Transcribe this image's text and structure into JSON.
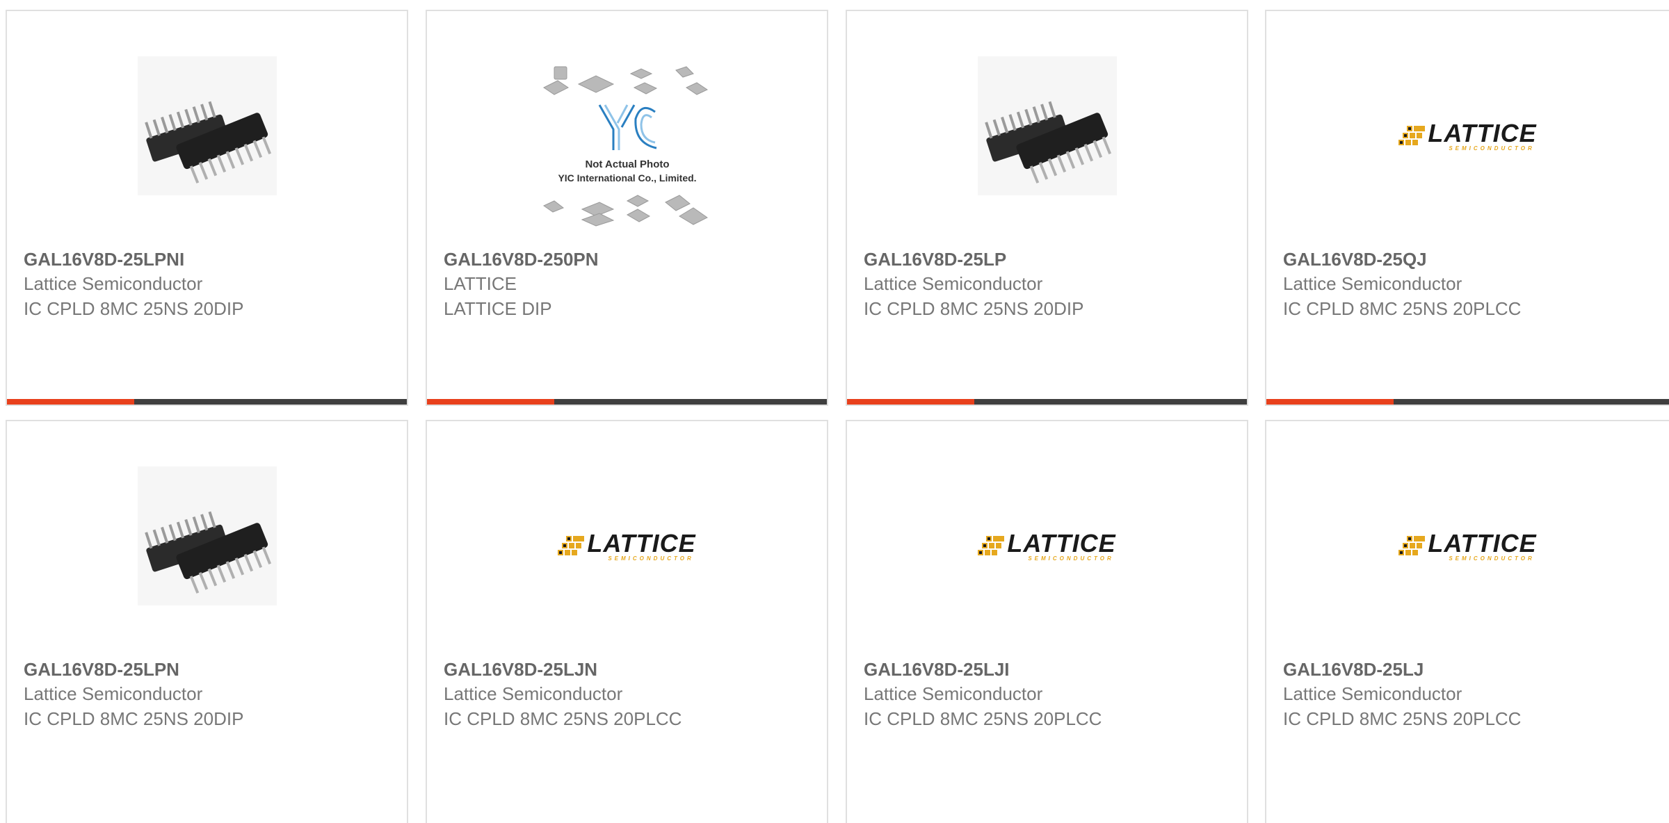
{
  "products": [
    {
      "part": "GAL16V8D-25LPNI",
      "manufacturer": "Lattice Semiconductor",
      "description": "IC CPLD 8MC 25NS 20DIP",
      "image": "dip-chip-photo"
    },
    {
      "part": "GAL16V8D-250PN",
      "manufacturer": "LATTICE",
      "description": "LATTICE DIP",
      "image": "yic-placeholder",
      "placeholder_text": {
        "line1": "Not Actual Photo",
        "line2": "YIC International Co., Limited.",
        "brand": "YIC"
      }
    },
    {
      "part": "GAL16V8D-25LP",
      "manufacturer": "Lattice Semiconductor",
      "description": "IC CPLD 8MC 25NS 20DIP",
      "image": "dip-chip-photo"
    },
    {
      "part": "GAL16V8D-25QJ",
      "manufacturer": "Lattice Semiconductor",
      "description": "IC CPLD 8MC 25NS 20PLCC",
      "image": "lattice-logo"
    },
    {
      "part": "GAL16V8D-25LPN",
      "manufacturer": "Lattice Semiconductor",
      "description": "IC CPLD 8MC 25NS 20DIP",
      "image": "dip-chip-photo"
    },
    {
      "part": "GAL16V8D-25LJN",
      "manufacturer": "Lattice Semiconductor",
      "description": "IC CPLD 8MC 25NS 20PLCC",
      "image": "lattice-logo"
    },
    {
      "part": "GAL16V8D-25LJI",
      "manufacturer": "Lattice Semiconductor",
      "description": "IC CPLD 8MC 25NS 20PLCC",
      "image": "lattice-logo"
    },
    {
      "part": "GAL16V8D-25LJ",
      "manufacturer": "Lattice Semiconductor",
      "description": "IC CPLD 8MC 25NS 20PLCC",
      "image": "lattice-logo"
    }
  ],
  "logo": {
    "lattice_word": "LATTICE",
    "lattice_tagline": "SEMICONDUCTOR"
  },
  "colors": {
    "accent": "#e8401c",
    "bar_dark": "#3f3f3f",
    "logo_gold": "#e6a81e",
    "yic_blue": "#2a7fc1"
  }
}
